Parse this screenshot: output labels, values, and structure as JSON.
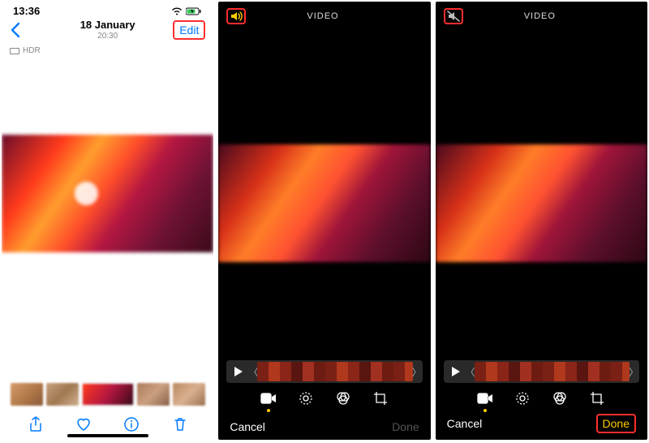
{
  "panel1": {
    "status_time": "13:36",
    "nav_title": "18 January",
    "nav_subtitle": "20:30",
    "edit_label": "Edit",
    "hdr_label": "HDR"
  },
  "panel2": {
    "header_label": "VIDEO",
    "cancel": "Cancel",
    "done": "Done",
    "sound_state": "on"
  },
  "panel3": {
    "header_label": "VIDEO",
    "cancel": "Cancel",
    "done": "Done",
    "sound_state": "muted"
  }
}
